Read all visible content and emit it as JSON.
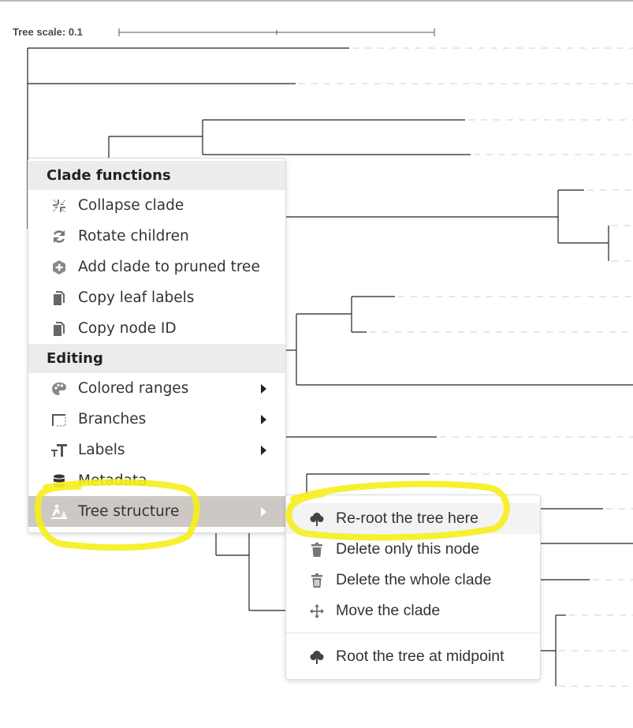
{
  "tree": {
    "scale_label": "Tree scale: 0.1"
  },
  "context_menu": {
    "sections": [
      {
        "header": "Clade functions",
        "items": [
          {
            "label": "Collapse clade",
            "icon": "collapse-icon"
          },
          {
            "label": "Rotate children",
            "icon": "rotate-icon"
          },
          {
            "label": "Add clade to pruned tree",
            "icon": "plus-circle-icon"
          },
          {
            "label": "Copy leaf labels",
            "icon": "copy-icon"
          },
          {
            "label": "Copy node ID",
            "icon": "copy-icon"
          }
        ]
      },
      {
        "header": "Editing",
        "items": [
          {
            "label": "Colored ranges",
            "icon": "palette-icon",
            "has_submenu": true
          },
          {
            "label": "Branches",
            "icon": "branches-icon",
            "has_submenu": true
          },
          {
            "label": "Labels",
            "icon": "text-icon",
            "has_submenu": true
          },
          {
            "label": "Metadata",
            "icon": "database-icon",
            "has_submenu": false
          },
          {
            "label": "Tree structure",
            "icon": "construction-icon",
            "has_submenu": true,
            "active": true
          }
        ]
      }
    ]
  },
  "submenu": {
    "items": [
      {
        "label": "Re-root the tree here",
        "icon": "tree-icon",
        "hover": true
      },
      {
        "label": "Delete only this node",
        "icon": "trash-icon"
      },
      {
        "label": "Delete the whole clade",
        "icon": "trash-full-icon"
      },
      {
        "label": "Move the clade",
        "icon": "move-icon"
      },
      {
        "label": "Root the tree at midpoint",
        "icon": "tree-icon"
      }
    ]
  },
  "colors": {
    "highlight": "#f5ee1a",
    "active_item": "#cdc8c4",
    "header_bg": "#ececec",
    "branch": "#222222",
    "leaf_dash": "#cfcfcf"
  }
}
